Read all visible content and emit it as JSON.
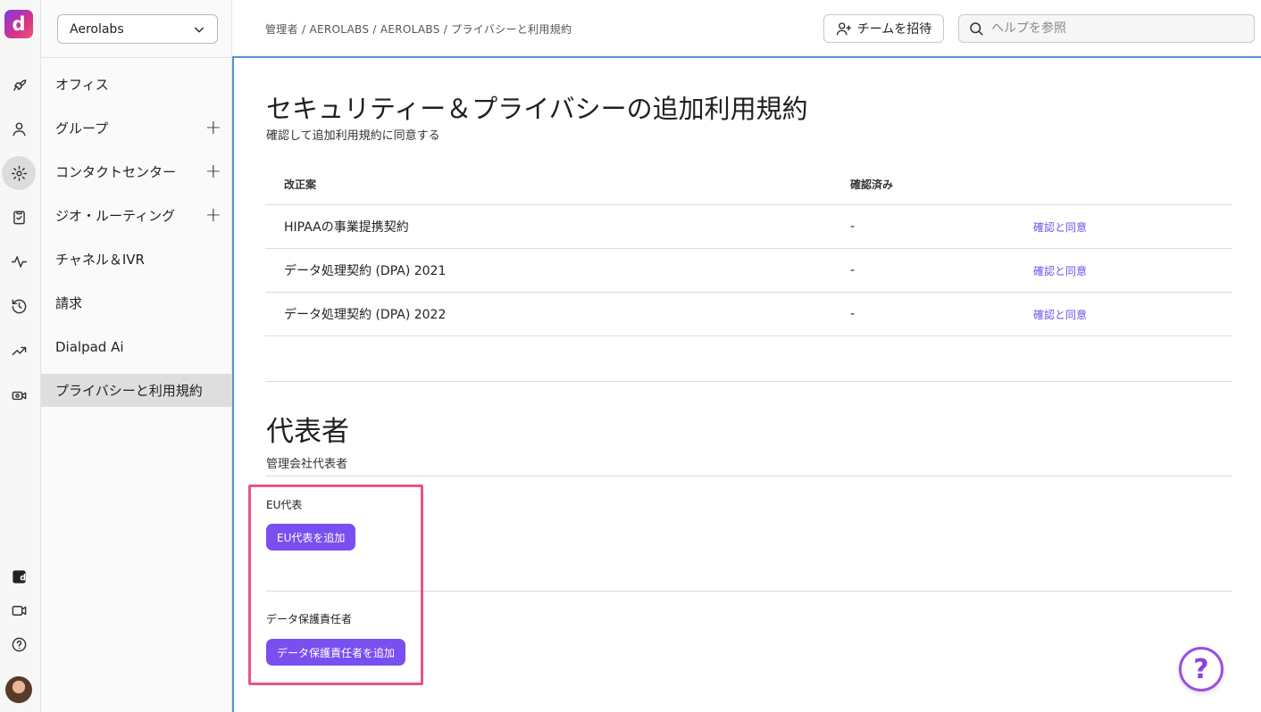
{
  "app": {
    "logo_glyph": "d",
    "accent": "#7a4ff0"
  },
  "rail": {
    "icons": [
      "rocket-icon",
      "person-icon",
      "gear-icon",
      "clipboard-icon",
      "activity-icon",
      "history-icon",
      "trending-icon",
      "camera-icon",
      "dialpad-app-icon",
      "video-icon",
      "help-icon",
      "avatar"
    ]
  },
  "sidebar": {
    "org_name": "Aerolabs",
    "items": [
      {
        "label": "オフィス"
      },
      {
        "label": "グループ",
        "expand": "+"
      },
      {
        "label": "コンタクトセンター",
        "expand": "+"
      },
      {
        "label": "ジオ・ルーティング",
        "expand": "+"
      },
      {
        "label": "チャネル＆IVR"
      },
      {
        "label": "請求"
      },
      {
        "label": "Dialpad Ai"
      },
      {
        "label": "プライバシーと利用規約"
      }
    ]
  },
  "header": {
    "breadcrumb": "管理者 / AEROLABS / AEROLABS / プライバシーと利用規約",
    "invite_label": "チームを招待",
    "search_placeholder": "ヘルプを参照"
  },
  "terms": {
    "title": "セキュリティー＆プライバシーの追加利用規約",
    "subtitle": "確認して追加利用規約に同意する",
    "columns": [
      "改正案",
      "確認済み"
    ],
    "rows": [
      {
        "name": "HIPAAの事業提携契約",
        "confirmed": "-",
        "action": "確認と同意"
      },
      {
        "name": "データ処理契約 (DPA) 2021",
        "confirmed": "-",
        "action": "確認と同意"
      },
      {
        "name": "データ処理契約 (DPA) 2022",
        "confirmed": "-",
        "action": "確認と同意"
      }
    ]
  },
  "representatives": {
    "title": "代表者",
    "subtitle": "管理会社代表者",
    "eu_label": "EU代表",
    "eu_button": "EU代表を追加",
    "dpo_label": "データ保護責任者",
    "dpo_button": "データ保護責任者を追加"
  },
  "help_fab": "?"
}
